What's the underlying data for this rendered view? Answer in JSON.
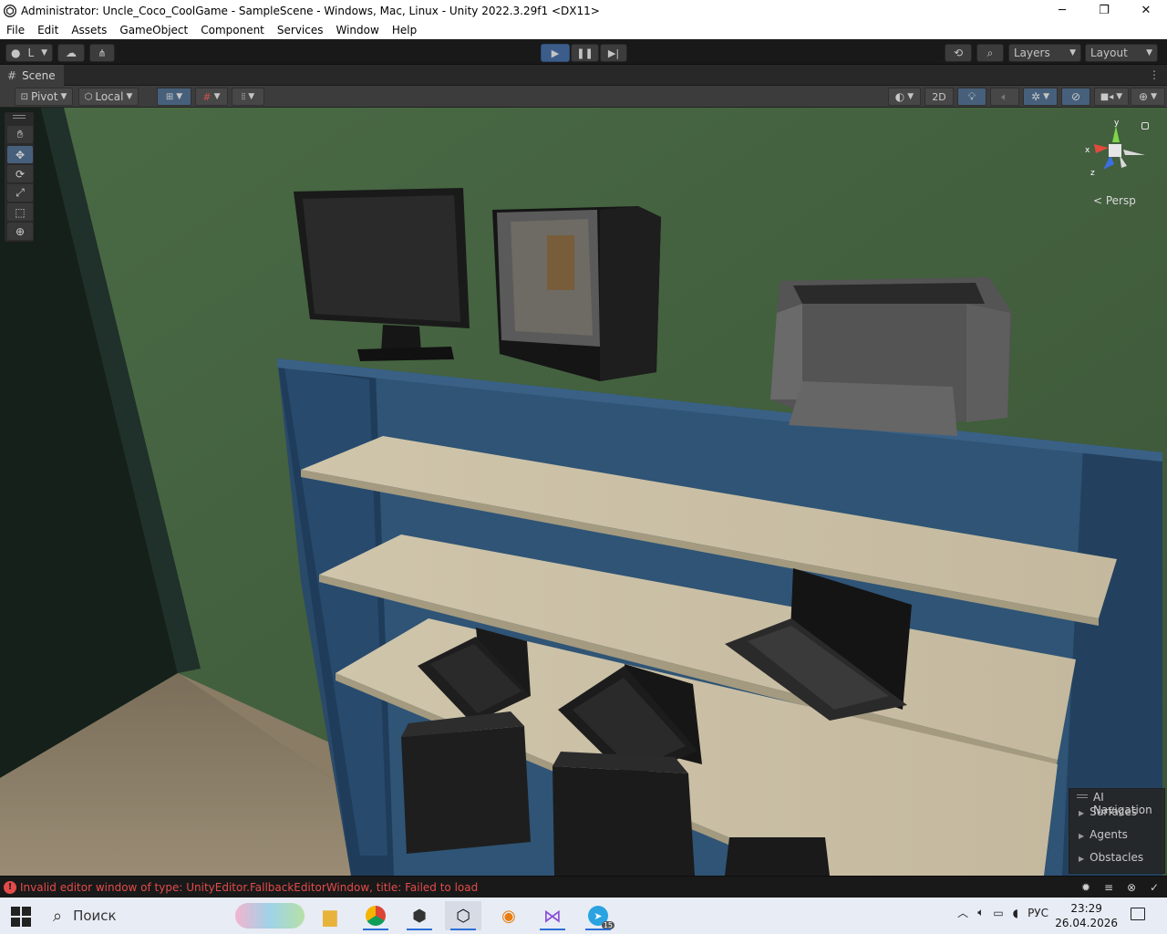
{
  "window": {
    "title": "Administrator: Uncle_Coco_CoolGame - SampleScene - Windows, Mac, Linux - Unity 2022.3.29f1 <DX11>",
    "minimize": "─",
    "restore": "❐",
    "close": "✕"
  },
  "menu": [
    "File",
    "Edit",
    "Assets",
    "GameObject",
    "Component",
    "Services",
    "Window",
    "Help"
  ],
  "toolbar": {
    "account_label": "L",
    "layers_label": "Layers",
    "layout_label": "Layout"
  },
  "scene_tab": {
    "label": "Scene"
  },
  "scene_toolbar": {
    "pivot_label": "Pivot",
    "local_label": "Local",
    "mode_2d": "2D"
  },
  "gizmo": {
    "y": "y",
    "x": "x",
    "z": "z",
    "projection": "< Persp"
  },
  "ai_navigation": {
    "title": "AI Navigation",
    "items": [
      "Surfaces",
      "Agents",
      "Obstacles"
    ]
  },
  "status": {
    "message": "Invalid editor window of type: UnityEditor.FallbackEditorWindow, title: Failed to load",
    "error_color": "#e34b4b"
  },
  "taskbar": {
    "search_placeholder": "Поиск",
    "language": "РУС",
    "time": "23:29",
    "date": "26.04.2026",
    "badge": "15",
    "apps": [
      "file-explorer",
      "chrome",
      "unity-hub",
      "unity",
      "blender",
      "visual-studio",
      "telegram"
    ]
  }
}
